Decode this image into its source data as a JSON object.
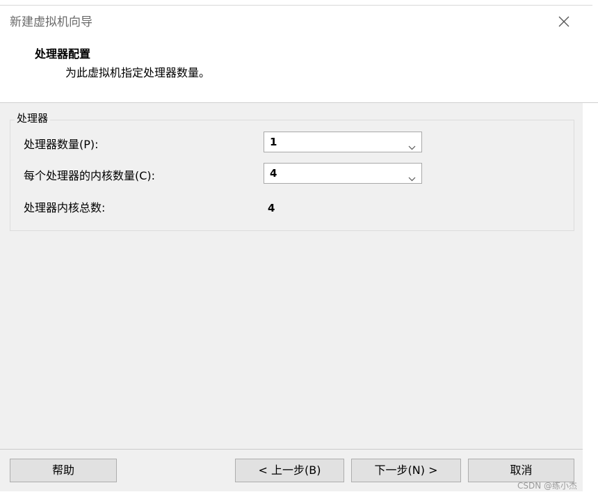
{
  "window": {
    "title": "新建虚拟机向导",
    "close_icon": "close-icon"
  },
  "header": {
    "title": "处理器配置",
    "subtitle": "为此虚拟机指定处理器数量。"
  },
  "processor_group": {
    "label": "处理器",
    "processor_count": {
      "label_cn": "处理器数量",
      "label_key": "(P):",
      "value": "1"
    },
    "cores_per_processor": {
      "label_cn": "每个处理器的内核数量",
      "label_key": "(C):",
      "value": "4"
    },
    "total_cores": {
      "label_cn": "处理器内核总数",
      "label_key": ":",
      "value": "4"
    }
  },
  "footer": {
    "help": "帮助",
    "back": {
      "prefix": "< ",
      "cn": "上一步",
      "key": "(B)"
    },
    "next": {
      "cn": "下一步",
      "key": "(N) >"
    },
    "cancel": "取消"
  },
  "watermark": "CSDN @练小杰",
  "colors": {
    "panel_background": "#f0f0f0",
    "button_background": "#e1e1e1",
    "button_border": "#adadad",
    "title_text": "#6a6a6a"
  }
}
